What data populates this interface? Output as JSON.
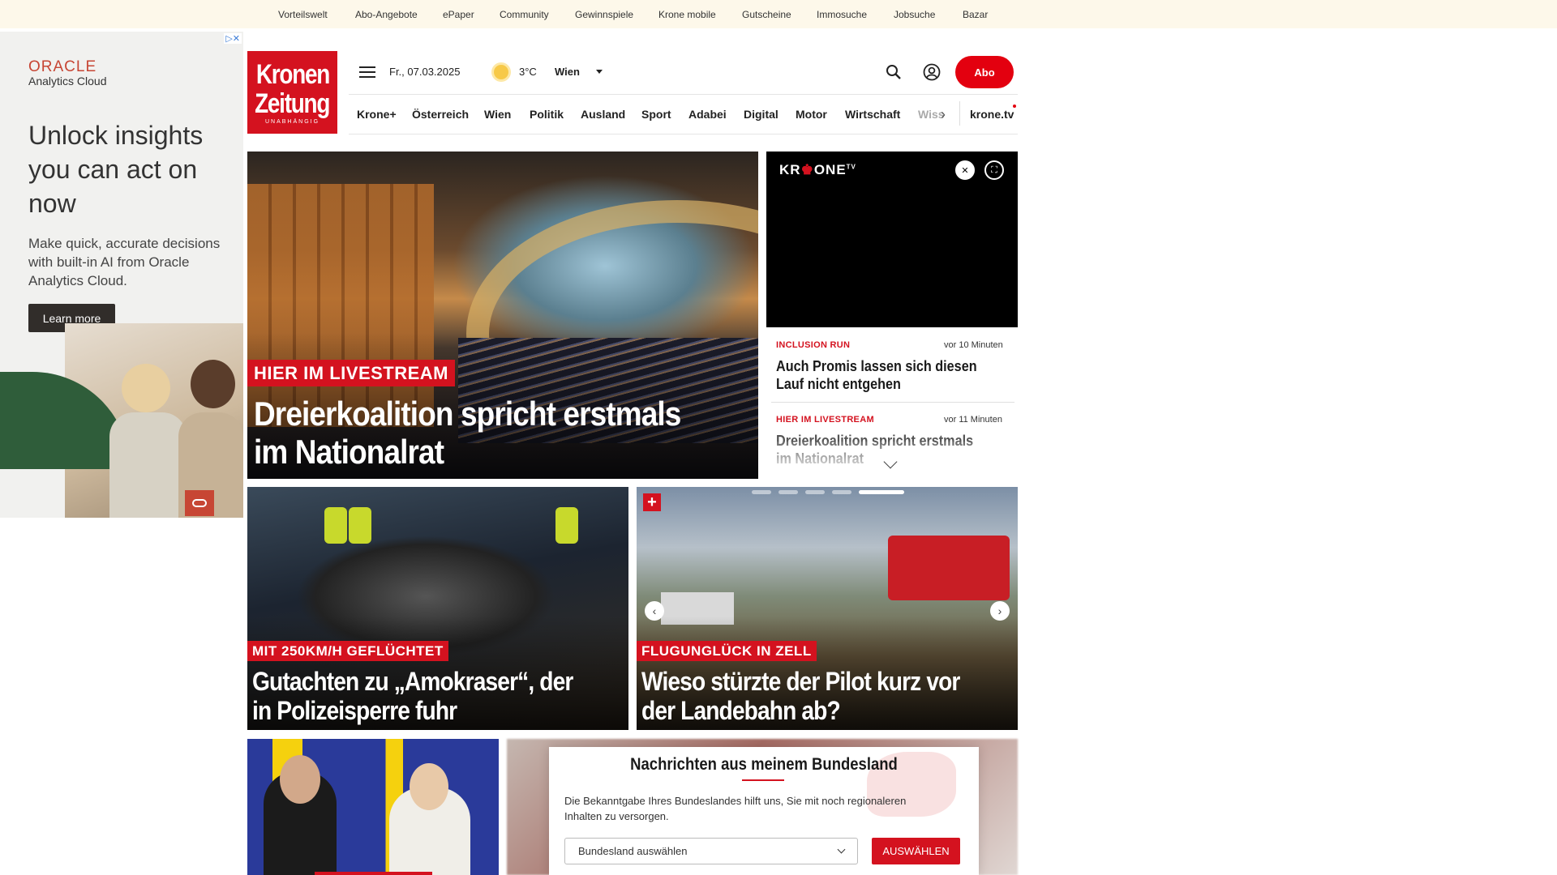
{
  "topbar": {
    "links": [
      "Vorteilswelt",
      "Abo-Angebote",
      "ePaper",
      "Community",
      "Gewinnspiele",
      "Krone mobile",
      "Gutscheine",
      "Immosuche",
      "Jobsuche",
      "Bazar"
    ]
  },
  "ad": {
    "brand": "ORACLE",
    "product": "Analytics Cloud",
    "headline": "Unlock insights you can act on now",
    "body": "Make quick, accurate decisions with built-in AI from Oracle Analytics Cloud.",
    "cta": "Learn more",
    "adchoices": "▷✕"
  },
  "header": {
    "logo_line1": "Kronen",
    "logo_line2": "Zeitung",
    "logo_tagline": "UNABHÄNGIG",
    "date": "Fr., 07.03.2025",
    "temperature": "3°C",
    "city": "Wien",
    "abo_label": "Abo"
  },
  "nav": {
    "items": [
      "Krone+",
      "Österreich",
      "Wien",
      "Politik",
      "Ausland",
      "Sport",
      "Adabei",
      "Digital",
      "Motor",
      "Wirtschaft"
    ],
    "truncated": "Wiss",
    "tv": "krone.tv"
  },
  "hero": {
    "tag": "HIER IM LIVESTREAM",
    "title": "Dreierkoalition spricht erstmals im Nationalrat"
  },
  "video": {
    "brand_a": "KR",
    "brand_b": "♚",
    "brand_c": "ONE",
    "brand_sup": "TV"
  },
  "side": {
    "items": [
      {
        "kicker": "INCLUSION RUN",
        "time": "vor 10 Minuten",
        "title": "Auch Promis lassen sich diesen Lauf nicht entgehen"
      },
      {
        "kicker": "HIER IM LIVESTREAM",
        "time": "vor 11 Minuten",
        "title": "Dreierkoalition spricht erstmals im Nationalrat"
      }
    ]
  },
  "cards": [
    {
      "tag": "MIT 250KM/H GEFLÜCHTET",
      "title": "Gutachten zu „Amokraser“, der in Polizeisperre fuhr"
    },
    {
      "tag": "FLUGUNGLÜCK IN ZELL",
      "title": "Wieso stürzte der Pilot kurz vor der Landebahn ab?"
    }
  ],
  "modal": {
    "title": "Nachrichten aus meinem Bundesland",
    "text": "Die Bekanntgabe Ihres Bundeslandes hilft uns, Sie mit noch regionaleren Inhalten zu versorgen.",
    "select_placeholder": "Bundesland auswählen",
    "button": "AUSWÄHLEN"
  },
  "colors": {
    "brand_red": "#d4121f",
    "topbar_bg": "#fdf8ea"
  }
}
